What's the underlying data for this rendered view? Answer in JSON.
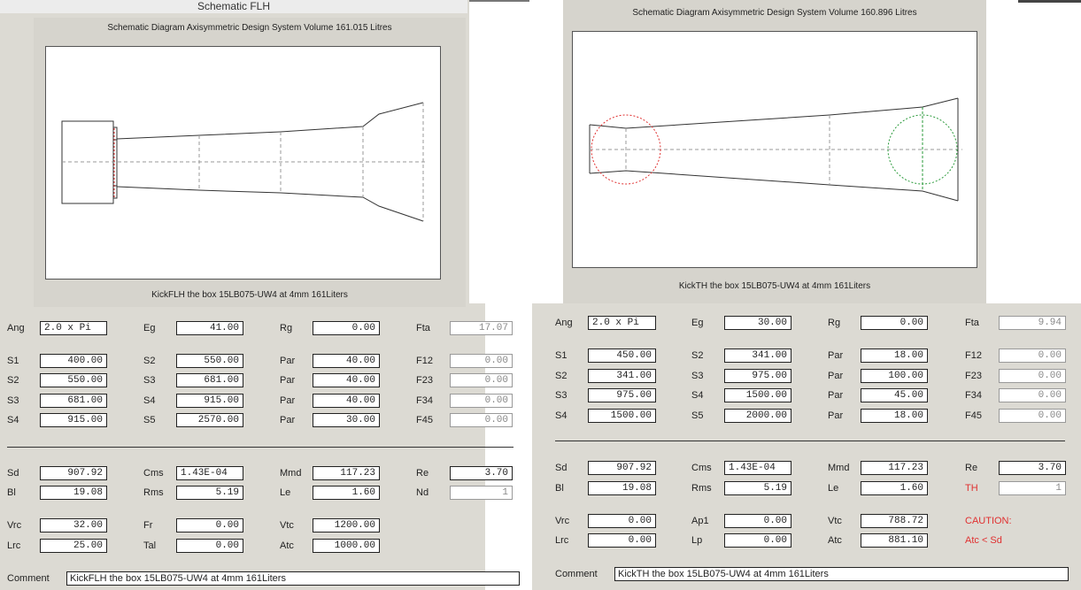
{
  "left": {
    "window_title": "Schematic FLH",
    "diagram_header": "Schematic Diagram   Axisymmetric Design   System Volume 161.015 Litres",
    "diagram_footer": "KickFLH the box 15LB075-UW4 at 4mm  161Liters",
    "fields": {
      "ang": {
        "label": "Ang",
        "value": "2.0 x Pi"
      },
      "eg": {
        "label": "Eg",
        "value": "41.00"
      },
      "rg": {
        "label": "Rg",
        "value": "0.00"
      },
      "fta": {
        "label": "Fta",
        "value": "17.07"
      },
      "s1": {
        "label": "S1",
        "value": "400.00"
      },
      "s2b": {
        "label": "S2",
        "value": "550.00"
      },
      "par1": {
        "label": "Par",
        "value": "40.00"
      },
      "f12": {
        "label": "F12",
        "value": "0.00"
      },
      "s2": {
        "label": "S2",
        "value": "550.00"
      },
      "s3b": {
        "label": "S3",
        "value": "681.00"
      },
      "par2": {
        "label": "Par",
        "value": "40.00"
      },
      "f23": {
        "label": "F23",
        "value": "0.00"
      },
      "s3": {
        "label": "S3",
        "value": "681.00"
      },
      "s4b": {
        "label": "S4",
        "value": "915.00"
      },
      "par3": {
        "label": "Par",
        "value": "40.00"
      },
      "f34": {
        "label": "F34",
        "value": "0.00"
      },
      "s4": {
        "label": "S4",
        "value": "915.00"
      },
      "s5b": {
        "label": "S5",
        "value": "2570.00"
      },
      "par4": {
        "label": "Par",
        "value": "30.00"
      },
      "f45": {
        "label": "F45",
        "value": "0.00"
      },
      "sd": {
        "label": "Sd",
        "value": "907.92"
      },
      "cms": {
        "label": "Cms",
        "value": "1.43E-04"
      },
      "mmd": {
        "label": "Mmd",
        "value": "117.23"
      },
      "re": {
        "label": "Re",
        "value": "3.70"
      },
      "bl": {
        "label": "Bl",
        "value": "19.08"
      },
      "rms": {
        "label": "Rms",
        "value": "5.19"
      },
      "le": {
        "label": "Le",
        "value": "1.60"
      },
      "nd": {
        "label": "Nd",
        "value": "1"
      },
      "vrc": {
        "label": "Vrc",
        "value": "32.00"
      },
      "fr": {
        "label": "Fr",
        "value": "0.00"
      },
      "vtc": {
        "label": "Vtc",
        "value": "1200.00"
      },
      "lrc": {
        "label": "Lrc",
        "value": "25.00"
      },
      "tal": {
        "label": "Tal",
        "value": "0.00"
      },
      "atc": {
        "label": "Atc",
        "value": "1000.00"
      }
    },
    "comment": {
      "label": "Comment",
      "value": "KickFLH the box 15LB075-UW4 at 4mm  161Liters"
    }
  },
  "right": {
    "diagram_header": "Schematic Diagram   Axisymmetric Design   System Volume 160.896 Litres",
    "diagram_footer": "KickTH the box 15LB075-UW4 at 4mm  161Liters",
    "fields": {
      "ang": {
        "label": "Ang",
        "value": "2.0 x Pi"
      },
      "eg": {
        "label": "Eg",
        "value": "30.00"
      },
      "rg": {
        "label": "Rg",
        "value": "0.00"
      },
      "fta": {
        "label": "Fta",
        "value": "9.94"
      },
      "s1": {
        "label": "S1",
        "value": "450.00"
      },
      "s2b": {
        "label": "S2",
        "value": "341.00"
      },
      "par1": {
        "label": "Par",
        "value": "18.00"
      },
      "f12": {
        "label": "F12",
        "value": "0.00"
      },
      "s2": {
        "label": "S2",
        "value": "341.00"
      },
      "s3b": {
        "label": "S3",
        "value": "975.00"
      },
      "par2": {
        "label": "Par",
        "value": "100.00"
      },
      "f23": {
        "label": "F23",
        "value": "0.00"
      },
      "s3": {
        "label": "S3",
        "value": "975.00"
      },
      "s4b": {
        "label": "S4",
        "value": "1500.00"
      },
      "par3": {
        "label": "Par",
        "value": "45.00"
      },
      "f34": {
        "label": "F34",
        "value": "0.00"
      },
      "s4": {
        "label": "S4",
        "value": "1500.00"
      },
      "s5b": {
        "label": "S5",
        "value": "2000.00"
      },
      "par4": {
        "label": "Par",
        "value": "18.00"
      },
      "f45": {
        "label": "F45",
        "value": "0.00"
      },
      "sd": {
        "label": "Sd",
        "value": "907.92"
      },
      "cms": {
        "label": "Cms",
        "value": "1.43E-04"
      },
      "mmd": {
        "label": "Mmd",
        "value": "117.23"
      },
      "re": {
        "label": "Re",
        "value": "3.70"
      },
      "bl": {
        "label": "Bl",
        "value": "19.08"
      },
      "rms": {
        "label": "Rms",
        "value": "5.19"
      },
      "le": {
        "label": "Le",
        "value": "1.60"
      },
      "th": {
        "label": "TH",
        "value": "1"
      },
      "vrc": {
        "label": "Vrc",
        "value": "0.00"
      },
      "ap1": {
        "label": "Ap1",
        "value": "0.00"
      },
      "vtc": {
        "label": "Vtc",
        "value": "788.72"
      },
      "lrc": {
        "label": "Lrc",
        "value": "0.00"
      },
      "lp": {
        "label": "Lp",
        "value": "0.00"
      },
      "atc": {
        "label": "Atc",
        "value": "881.10"
      },
      "caution": "CAUTION:",
      "caution_detail": "Atc < Sd"
    },
    "comment": {
      "label": "Comment",
      "value": "KickTH the box 15LB075-UW4 at 4mm  161Liters"
    }
  },
  "colors": {
    "window_bg": "#dcdad3",
    "caution_red": "#e03030",
    "diagram_red": "#e03030",
    "diagram_green": "#2a9a3a"
  }
}
